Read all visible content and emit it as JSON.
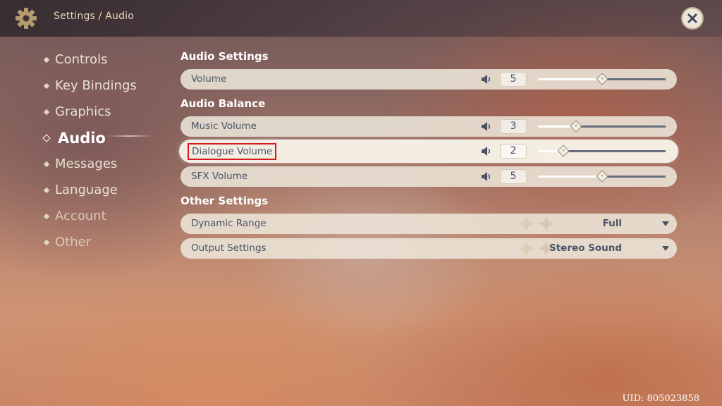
{
  "header": {
    "breadcrumb": "Settings / Audio",
    "settings_icon": "gear-icon",
    "close_icon": "close-icon"
  },
  "nav": {
    "items": [
      {
        "label": "Controls",
        "state": "normal"
      },
      {
        "label": "Key Bindings",
        "state": "normal"
      },
      {
        "label": "Graphics",
        "state": "normal"
      },
      {
        "label": "Audio",
        "state": "active"
      },
      {
        "label": "Messages",
        "state": "normal"
      },
      {
        "label": "Language",
        "state": "normal"
      },
      {
        "label": "Account",
        "state": "dim"
      },
      {
        "label": "Other",
        "state": "dim"
      }
    ]
  },
  "sections": {
    "audio_settings": "Audio Settings",
    "audio_balance": "Audio Balance",
    "other_settings": "Other Settings"
  },
  "sliders": {
    "volume": {
      "label": "Volume",
      "value": "5",
      "level": 0.5
    },
    "music": {
      "label": "Music Volume",
      "value": "3",
      "level": 0.3
    },
    "dialogue": {
      "label": "Dialogue Volume",
      "value": "2",
      "level": 0.2
    },
    "sfx": {
      "label": "SFX Volume",
      "value": "5",
      "level": 0.5
    }
  },
  "selects": {
    "dynamic_range": {
      "label": "Dynamic Range",
      "value": "Full"
    },
    "output": {
      "label": "Output Settings",
      "value": "Stereo Sound"
    }
  },
  "footer": {
    "uid": "UID: 805023858"
  },
  "colors": {
    "row_bg": "#ece5d8",
    "text": "#4a5366",
    "highlight_box": "#d9191c",
    "track_empty": "#67707e"
  }
}
